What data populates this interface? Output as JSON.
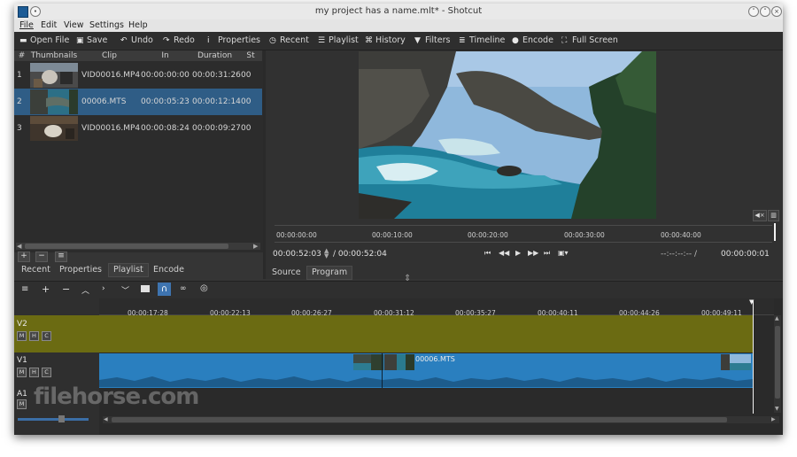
{
  "window": {
    "title": "my project has a name.mlt* - Shotcut",
    "controls": [
      "minimize-icon",
      "maximize-icon",
      "close-icon"
    ]
  },
  "menu": {
    "file": "File",
    "edit": "Edit",
    "view": "View",
    "settings": "Settings",
    "help": "Help"
  },
  "toolbar": {
    "open_file": "Open File",
    "save": "Save",
    "undo": "Undo",
    "redo": "Redo",
    "properties": "Properties",
    "recent": "Recent",
    "playlist": "Playlist",
    "history": "History",
    "filters": "Filters",
    "timeline": "Timeline",
    "encode": "Encode",
    "full_screen": "Full Screen"
  },
  "playlist": {
    "headers": {
      "num": "#",
      "thumbnails": "Thumbnails",
      "clip": "Clip",
      "in": "In",
      "duration": "Duration",
      "start": "St"
    },
    "rows": [
      {
        "num": "1",
        "clip": "VID00016.MP4",
        "in": "00:00:00:00",
        "duration": "00:00:31:26",
        "start": "00"
      },
      {
        "num": "2",
        "clip": "00006.MTS",
        "in": "00:00:05:23",
        "duration": "00:00:12:14",
        "start": "00"
      },
      {
        "num": "3",
        "clip": "VID00016.MP4",
        "in": "00:00:08:24",
        "duration": "00:00:09:27",
        "start": "00"
      }
    ],
    "selected_row": 2,
    "buttons": {
      "add": "+",
      "remove": "−",
      "menu": "≡"
    }
  },
  "left_tabs": {
    "recent": "Recent",
    "properties": "Properties",
    "playlist": "Playlist",
    "encode": "Encode"
  },
  "player": {
    "ruler": [
      "00:00:00:00",
      "00:00:10:00",
      "00:00:20:00",
      "00:00:30:00",
      "00:00:40:00"
    ],
    "position": "00:00:52:03",
    "duration": "/ 00:00:52:04",
    "in_out": "--:--:--:-- /",
    "remaining": "00:00:00:01",
    "tabs": {
      "source": "Source",
      "program": "Program"
    }
  },
  "timeline": {
    "ruler": [
      "00:00:17:28",
      "00:00:22:13",
      "00:00:26:27",
      "00:00:31:12",
      "00:00:35:27",
      "00:00:40:11",
      "00:00:44:26",
      "00:00:49:11"
    ],
    "tracks": {
      "v2": {
        "name": "V2",
        "m": "M",
        "h": "H",
        "c": "C"
      },
      "v1": {
        "name": "V1",
        "m": "M",
        "h": "H",
        "c": "C"
      },
      "a1": {
        "name": "A1",
        "m": "M"
      }
    },
    "clip_label": "00006.MTS"
  },
  "watermark": "filehorse.com",
  "colors": {
    "selected": "#2f5d86",
    "v2_track": "#6b6b12",
    "v1_clip": "#2a7fbf",
    "background": "#353535"
  }
}
